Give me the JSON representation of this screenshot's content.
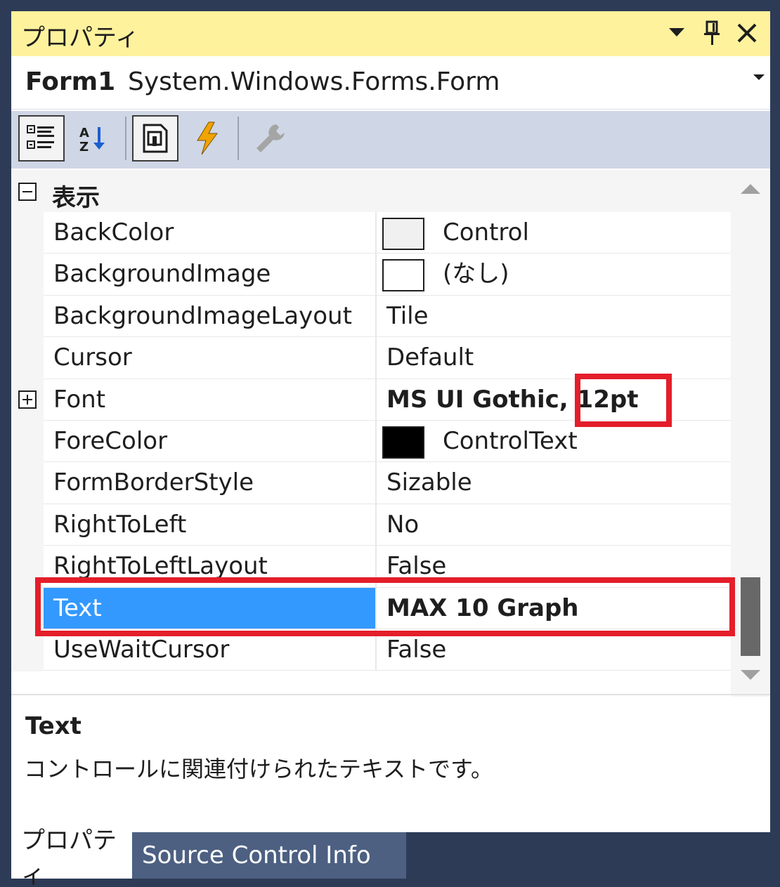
{
  "window": {
    "title": "プロパティ"
  },
  "object_selector": {
    "name": "Form1",
    "type": "System.Windows.Forms.Form"
  },
  "toolbar": {
    "buttons": [
      "categorized-icon",
      "alphabetical-icon",
      "properties-icon",
      "events-icon",
      "property-pages-icon"
    ]
  },
  "category": {
    "label": "表示"
  },
  "properties": [
    {
      "name": "BackColor",
      "value": "Control",
      "swatch": "#f0f0f0"
    },
    {
      "name": "BackgroundImage",
      "value": "(なし)",
      "swatch": "#ffffff"
    },
    {
      "name": "BackgroundImageLayout",
      "value": "Tile"
    },
    {
      "name": "Cursor",
      "value": "Default"
    },
    {
      "name": "Font",
      "value_prefix": "MS UI Gothic, ",
      "value_suffix": "12pt"
    },
    {
      "name": "ForeColor",
      "value": "ControlText",
      "swatch": "#000000"
    },
    {
      "name": "FormBorderStyle",
      "value": "Sizable"
    },
    {
      "name": "RightToLeft",
      "value": "No"
    },
    {
      "name": "RightToLeftLayout",
      "value": "False"
    },
    {
      "name": "Text",
      "value": "MAX 10 Graph"
    },
    {
      "name": "UseWaitCursor",
      "value": "False"
    }
  ],
  "description": {
    "title": "Text",
    "text": "コントロールに関連付けられたテキストです。"
  },
  "tabs": [
    {
      "label": "プロパティ"
    },
    {
      "label": "Source Control Info"
    }
  ],
  "colors": {
    "titlebar": "#fff29d",
    "selection": "#3399ff",
    "highlight": "#e41e2a",
    "background": "#2d3b56"
  }
}
